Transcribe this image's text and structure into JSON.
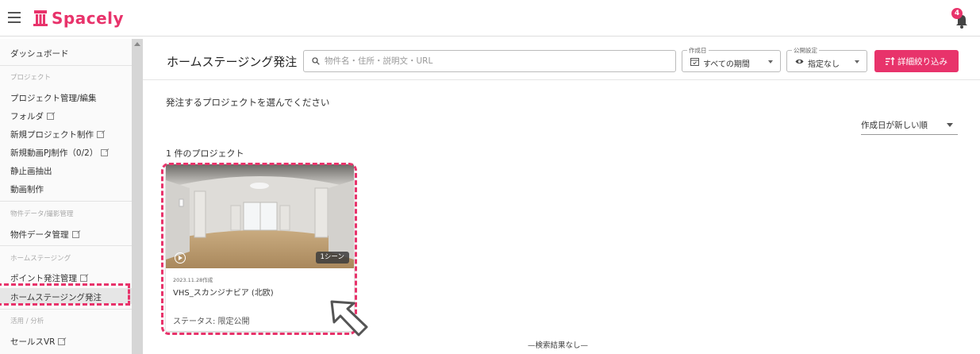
{
  "app": {
    "logo_text": "Spacely",
    "notification_count": "4",
    "brand_color": "#e8336b"
  },
  "sidebar": {
    "dashboard": "ダッシュボード",
    "section_project": "プロジェクト",
    "project_manage": "プロジェクト管理/編集",
    "folder": "フォルダ",
    "new_project": "新規プロジェクト制作",
    "new_video_project": "新規動画PJ制作（0/2）",
    "still_extract": "静止画抽出",
    "video_production": "動画制作",
    "section_property": "物件データ/撮影管理",
    "property_data": "物件データ管理",
    "section_homestaging": "ホームステージング",
    "point_order": "ポイント発注管理",
    "homestaging_order": "ホームステージング発注",
    "section_analytics": "活用 / 分析",
    "sales_vr": "セールスVR"
  },
  "header": {
    "title": "ホームステージング発注",
    "search_placeholder": "物件名・住所・説明文・URL",
    "date_legend": "作成日",
    "date_value": "すべての期間",
    "visibility_legend": "公開設定",
    "visibility_value": "指定なし",
    "filter_button": "詳細絞り込み"
  },
  "content": {
    "instruction": "発注するプロジェクトを選んでください",
    "sort_label": "作成日が新しい順",
    "project_count": "1 件のプロジェクト",
    "no_more_results": "—検索結果なし—"
  },
  "cards": [
    {
      "date": "2023.11.28作成",
      "title": "VHS_スカンジナビア (北欧)",
      "scene_count": "1シーン",
      "status": "ステータス: 限定公開"
    }
  ]
}
